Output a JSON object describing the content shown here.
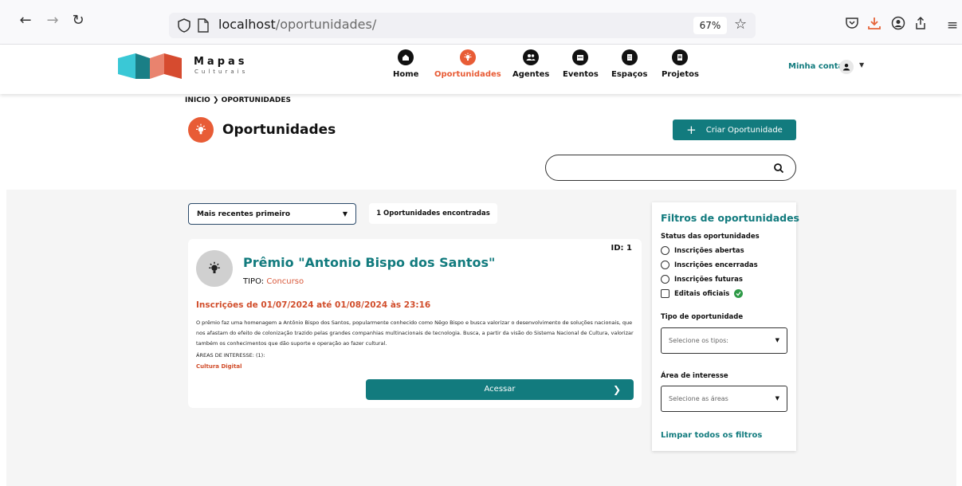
{
  "browser": {
    "url_host": "localhost",
    "url_path": "/oportunidades/",
    "zoom": "67%"
  },
  "site": {
    "logo_title": "Mapas",
    "logo_subtitle": "Culturais",
    "nav": [
      {
        "label": "Home",
        "icon": "home-icon"
      },
      {
        "label": "Oportunidades",
        "icon": "bulb-icon",
        "active": true
      },
      {
        "label": "Agentes",
        "icon": "agents-icon"
      },
      {
        "label": "Eventos",
        "icon": "calendar-icon"
      },
      {
        "label": "Espaços",
        "icon": "building-icon"
      },
      {
        "label": "Projetos",
        "icon": "document-icon"
      }
    ],
    "account_label": "Minha conta"
  },
  "page": {
    "breadcrumb_home": "INICIO",
    "breadcrumb_current": "OPORTUNIDADES",
    "title": "Oportunidades",
    "create_button": "Criar Oportunidade",
    "search_placeholder": ""
  },
  "results": {
    "sort_label": "Mais recentes primeiro",
    "count_label": "1 Oportunidades encontradas"
  },
  "card": {
    "id_label": "ID: 1",
    "title": "Prêmio \"Antonio Bispo dos Santos\"",
    "type_label": "TIPO:",
    "type_value": "Concurso",
    "dates": "Inscrições de 01/07/2024 até 01/08/2024 às 23:16",
    "description": "O prêmio faz uma homenagem a Antônio Bispo dos Santos, popularmente conhecido como Nêgo Bispo e busca valorizar o desenvolvimento de soluções nacionais, que nos afastam do efeito de colonização trazido pelas grandes companhias multinacionais de tecnologia. Busca, a partir da visão do Sistema Nacional de Cultura, valorizar também os conhecimentos que dão suporte e operação ao fazer cultural.",
    "areas_label": "ÁREAS DE INTERESSE: (1):",
    "area": "Cultura Digital",
    "access_button": "Acessar"
  },
  "filters": {
    "title": "Filtros de oportunidades",
    "status_label": "Status das oportunidades",
    "status_options": [
      "Inscrições abertas",
      "Inscrições encerradas",
      "Inscrições futuras"
    ],
    "official_label": "Editais oficiais",
    "type_label": "Tipo de oportunidade",
    "type_placeholder": "Selecione os tipos:",
    "area_label": "Área de interesse",
    "area_placeholder": "Selecione as áreas",
    "clear_label": "Limpar todos os filtros"
  },
  "colors": {
    "primary": "#127b7e",
    "accent": "#e85c36",
    "date_red": "#d14e2c",
    "verified_green": "#2e9a47"
  }
}
